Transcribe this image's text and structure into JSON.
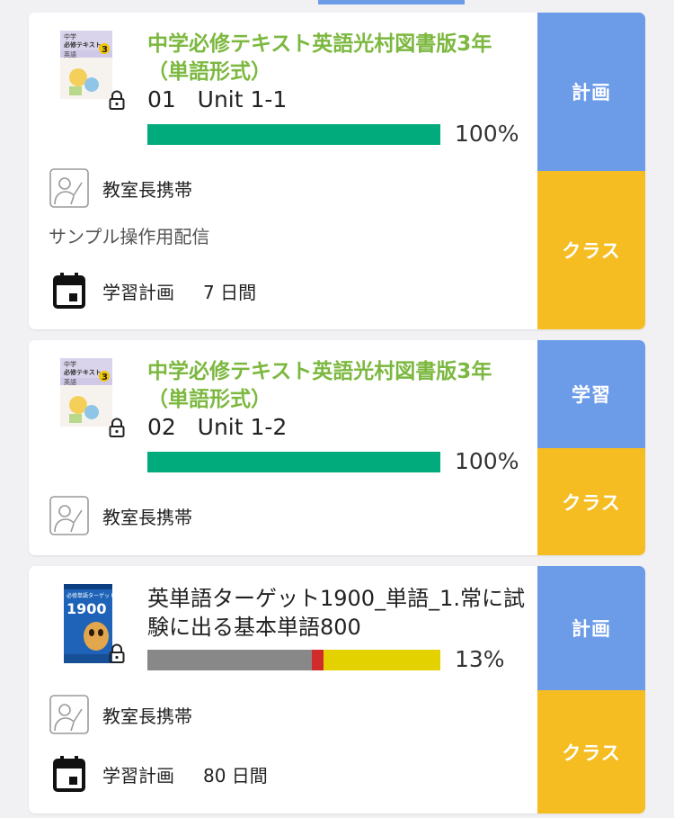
{
  "colors": {
    "accent_blue": "#6c9be8",
    "accent_yellow": "#f5bd22",
    "title_green": "#7cb83f",
    "progress_green": "#01ab7b",
    "progress_gray": "#888888",
    "progress_red": "#d02c2c",
    "progress_yellow": "#e3d200"
  },
  "cards": [
    {
      "title": "中学必修テキスト英語光村図書版3年（単語形式）",
      "subtitle": "01   Unit 1-1",
      "progress_percent": 100,
      "progress_label": "100%",
      "group_label": "教室長携帯",
      "note": "サンプル操作用配信",
      "plan_label": "学習計画",
      "plan_days": "7 日間",
      "side_top": "計画",
      "side_bottom": "クラス",
      "icons": [
        "book-cover-icon",
        "lock-icon",
        "teacher-board-icon",
        "calendar-icon"
      ]
    },
    {
      "title": "中学必修テキスト英語光村図書版3年（単語形式）",
      "subtitle": "02   Unit 1-2",
      "progress_percent": 100,
      "progress_label": "100%",
      "group_label": "教室長携帯",
      "side_top": "学習",
      "side_bottom": "クラス",
      "icons": [
        "book-cover-icon",
        "lock-icon",
        "teacher-board-icon"
      ]
    },
    {
      "title": "英単語ターゲット1900_単語_1.常に試験に出る基本単語800",
      "progress_percent": 13,
      "progress_segments": [
        {
          "label": "gray",
          "fraction": 0.56
        },
        {
          "label": "red",
          "fraction": 0.04
        },
        {
          "label": "yellow",
          "fraction": 0.4
        }
      ],
      "progress_label": "13%",
      "group_label": "教室長携帯",
      "plan_label": "学習計画",
      "plan_days": "80 日間",
      "side_top": "計画",
      "side_bottom": "クラス",
      "icons": [
        "book-cover-icon",
        "lock-icon",
        "teacher-board-icon",
        "calendar-icon"
      ]
    }
  ],
  "book_covers": {
    "text_cover_line1": "中学",
    "text_cover_line2": "必修テキスト",
    "text_cover_subject": "英語",
    "text_cover_grade": "3",
    "target_cover_title": "必修単語ターゲット",
    "target_cover_number": "1900"
  }
}
